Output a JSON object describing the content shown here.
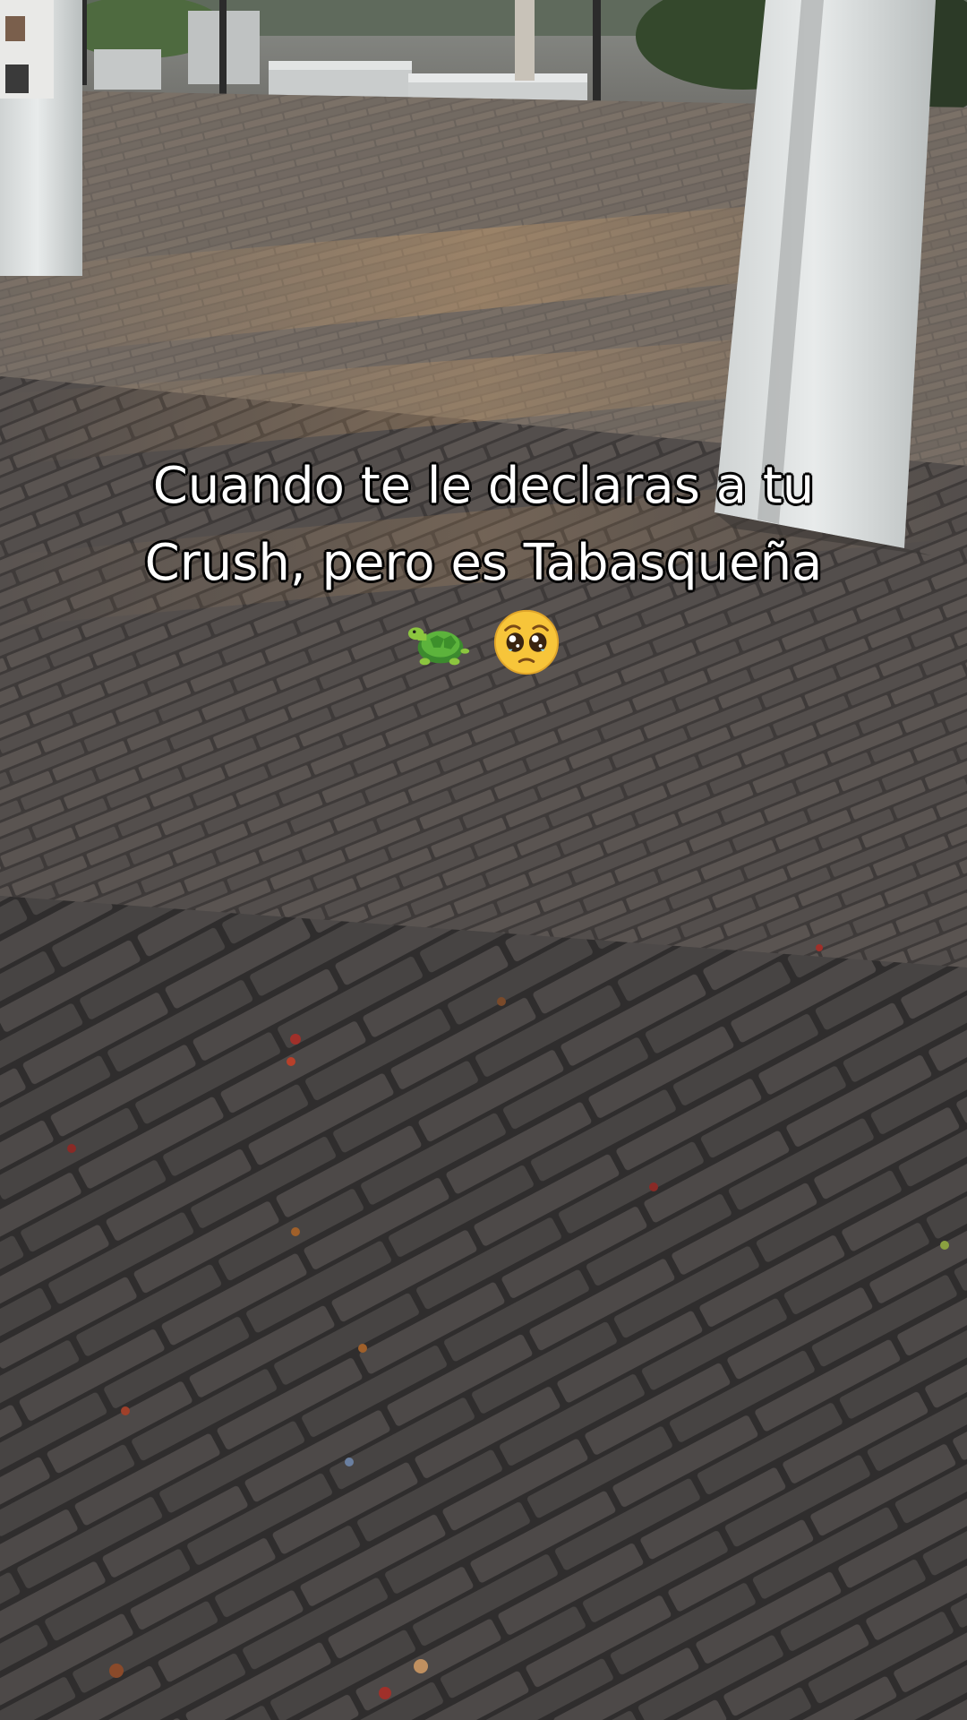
{
  "caption": {
    "line1": "Cuando te le declaras a tu",
    "line2": "Crush, pero es Tabasqueña",
    "emojis": [
      "turtle-emoji",
      "pleading-face-emoji"
    ]
  },
  "colors": {
    "caption_text": "#ffffff",
    "caption_outline": "#000000",
    "pavement": "#4a4543",
    "pillar": "#d9dcdc"
  }
}
